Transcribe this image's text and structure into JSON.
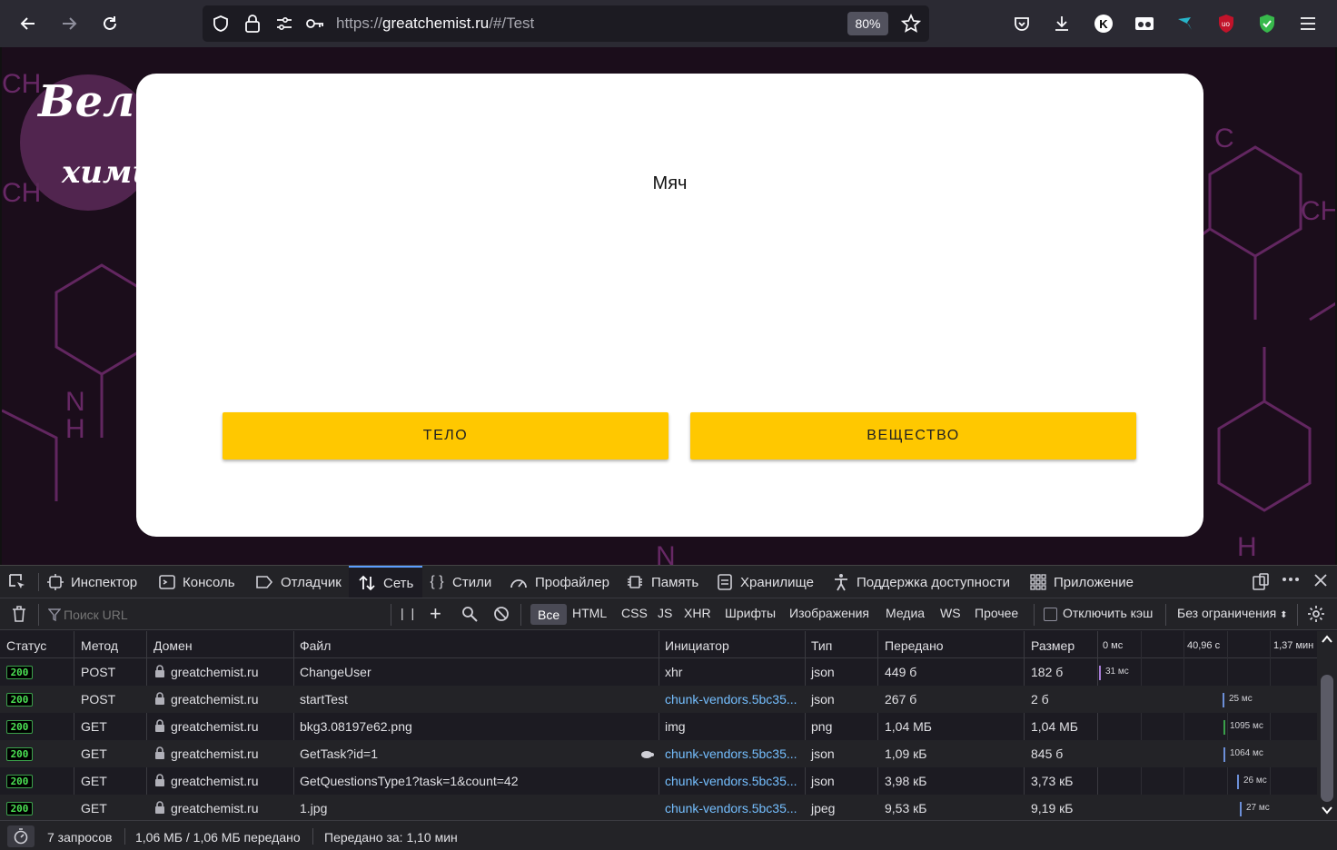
{
  "browser": {
    "url_scheme": "https://",
    "url_host": "greatchemist.ru",
    "url_path": "/#/Test",
    "zoom": "80%",
    "ext_k_letter": "K"
  },
  "page": {
    "logo_line1": "Вели",
    "logo_line2": "хими",
    "question": "Мяч",
    "answers": [
      "ТЕЛО",
      "ВЕЩЕСТВО"
    ]
  },
  "devtools": {
    "tabs": [
      "Инспектор",
      "Консоль",
      "Отладчик",
      "Сеть",
      "Стили",
      "Профайлер",
      "Память",
      "Хранилище",
      "Поддержка доступности",
      "Приложение"
    ],
    "search_placeholder": "Поиск URL",
    "filters": [
      "Все",
      "HTML",
      "CSS",
      "JS",
      "XHR",
      "Шрифты",
      "Изображения",
      "Медиа",
      "WS",
      "Прочее"
    ],
    "disable_cache_label": "Отключить кэш",
    "throttle_label": "Без ограничения",
    "columns": [
      "Статус",
      "Метод",
      "Домен",
      "Файл",
      "Инициатор",
      "Тип",
      "Передано",
      "Размер"
    ],
    "waterfall_ticks": [
      "0 мс",
      "40,96 с",
      "1,37 мин"
    ],
    "rows": [
      {
        "status": "200",
        "method": "POST",
        "domain": "greatchemist.ru",
        "file": "ChangeUser",
        "initiator": "xhr",
        "type": "json",
        "transferred": "449 б",
        "size": "182 б",
        "timing": "31 мс"
      },
      {
        "status": "200",
        "method": "POST",
        "domain": "greatchemist.ru",
        "file": "startTest",
        "initiator": "chunk-vendors.5bc35...",
        "type": "json",
        "transferred": "267 б",
        "size": "2 б",
        "timing": "25 мс"
      },
      {
        "status": "200",
        "method": "GET",
        "domain": "greatchemist.ru",
        "file": "bkg3.08197e62.png",
        "initiator": "img",
        "type": "png",
        "transferred": "1,04 МБ",
        "size": "1,04 МБ",
        "timing": "1095 мс"
      },
      {
        "status": "200",
        "method": "GET",
        "domain": "greatchemist.ru",
        "file": "GetTask?id=1",
        "initiator": "chunk-vendors.5bc35...",
        "type": "json",
        "transferred": "1,09 кБ",
        "size": "845 б",
        "timing": "1064 мс"
      },
      {
        "status": "200",
        "method": "GET",
        "domain": "greatchemist.ru",
        "file": "GetQuestionsType1?task=1&count=42",
        "initiator": "chunk-vendors.5bc35...",
        "type": "json",
        "transferred": "3,98 кБ",
        "size": "3,73 кБ",
        "timing": "26 мс"
      },
      {
        "status": "200",
        "method": "GET",
        "domain": "greatchemist.ru",
        "file": "1.jpg",
        "initiator": "chunk-vendors.5bc35...",
        "type": "jpeg",
        "transferred": "9,53 кБ",
        "size": "9,19 кБ",
        "timing": "27 мс"
      }
    ],
    "summary_requests": "7 запросов",
    "summary_transferred": "1,06 МБ / 1,06 МБ передано",
    "summary_time": "Передано за: 1,10 мин"
  }
}
